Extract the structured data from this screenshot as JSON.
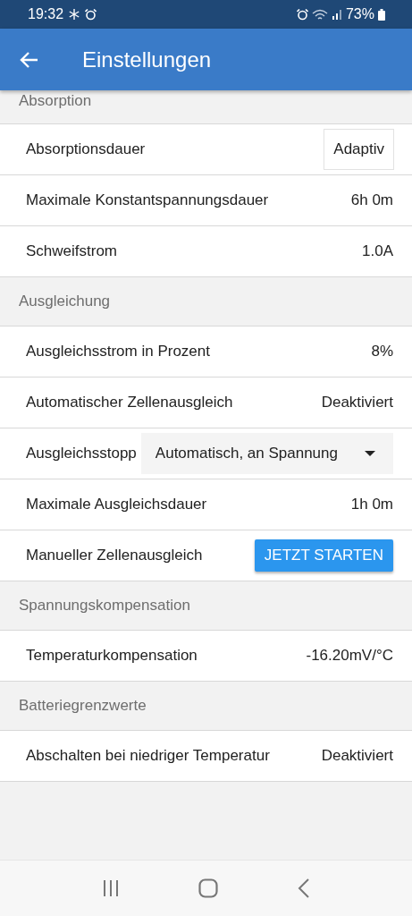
{
  "status_bar": {
    "time": "19:32",
    "battery": "73%"
  },
  "app_bar": {
    "title": "Einstellungen"
  },
  "sections": [
    {
      "title": "Absorption",
      "rows": [
        {
          "kind": "boxed",
          "label": "Absorptionsdauer",
          "value": "Adaptiv"
        },
        {
          "kind": "value",
          "label": "Maximale Konstantspannungsdauer",
          "value": "6h 0m"
        },
        {
          "kind": "value",
          "label": "Schweifstrom",
          "value": "1.0A"
        }
      ]
    },
    {
      "title": "Ausgleichung",
      "rows": [
        {
          "kind": "value",
          "label": "Ausgleichsstrom in Prozent",
          "value": "8%"
        },
        {
          "kind": "value",
          "label": "Automatischer Zellenausgleich",
          "value": "Deaktiviert"
        },
        {
          "kind": "dropdown",
          "label": "Ausgleichsstopp",
          "value": "Automatisch, an Spannung"
        },
        {
          "kind": "value",
          "label": "Maximale Ausgleichsdauer",
          "value": "1h 0m"
        },
        {
          "kind": "button",
          "label": "Manueller Zellenausgleich",
          "value": "JETZT STARTEN"
        }
      ]
    },
    {
      "title": "Spannungskompensation",
      "rows": [
        {
          "kind": "value",
          "label": "Temperaturkompensation",
          "value": "-16.20mV/°C"
        }
      ]
    },
    {
      "title": "Batteriegrenzwerte",
      "rows": [
        {
          "kind": "value",
          "label": "Abschalten bei niedriger Temperatur",
          "value": "Deaktiviert"
        }
      ]
    }
  ]
}
